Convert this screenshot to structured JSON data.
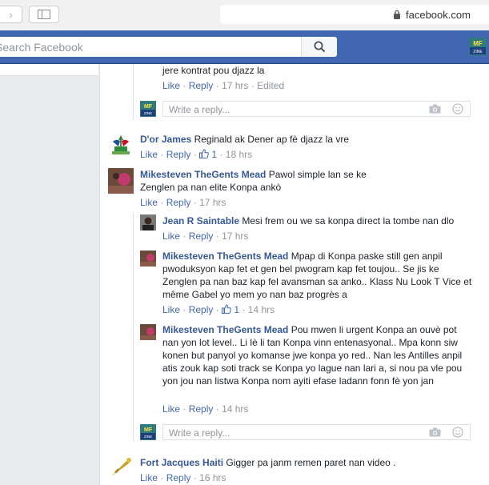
{
  "browser": {
    "url": "facebook.com",
    "back_glyph": "‹",
    "forward_glyph": "›"
  },
  "header": {
    "search_placeholder": "Search Facebook",
    "brand_color": "#4267b2"
  },
  "comments": [
    {
      "text_tail": "jere kontrat pou djazz la",
      "actions": {
        "like": "Like",
        "reply": "Reply",
        "time": "17 hrs",
        "edited": "Edited"
      }
    },
    {
      "name": "D'or James",
      "text": "Reginald ak Dener ap fè djazz la vre",
      "actions": {
        "like": "Like",
        "reply": "Reply",
        "likes_count": "1",
        "time": "18 hrs"
      }
    },
    {
      "name": "Mikesteven TheGents Mead",
      "text": "Pawol simple lan se ke Zenglen pa nan elite Konpa ankò",
      "actions": {
        "like": "Like",
        "reply": "Reply",
        "time": "17 hrs"
      },
      "replies": [
        {
          "name": "Jean R Saintable",
          "text": "Mesi frem ou we sa konpa direct la tombe nan dlo",
          "actions": {
            "like": "Like",
            "reply": "Reply",
            "time": "17 hrs"
          }
        },
        {
          "name": "Mikesteven TheGents Mead",
          "text": "Mpap di Konpa paske still gen anpil pwoduksyon kap fet et gen bel pwogram kap fet toujou.. Se jis ke Zenglen pa nan baz kap fel avansman sa anko.. Klass Nu Look T Vice et même Gabel yo mem yo nan baz progrès a",
          "actions": {
            "like": "Like",
            "reply": "Reply",
            "likes_count": "1",
            "time": "14 hrs"
          }
        },
        {
          "name": "Mikesteven TheGents Mead",
          "text": "Pou mwen li urgent Konpa an ouvè pot nan yon lot level.. Li lè li tan Konpa vinn entenasyonal.. Mpa konn siw konen but panyol yo komanse jwe konpa yo red.. Nan les Antilles anpil atis zouk kap soti track se Konpa yo lague nan lari a, si nou pa vle pou yon jou nan listwa Konpa nom ayiti efase ladann fonn fè yon jan",
          "actions": {
            "like": "Like",
            "reply": "Reply",
            "time": "14 hrs"
          }
        }
      ]
    },
    {
      "name": "Fort Jacques Haiti",
      "text": "Gigger pa janm remen paret nan video .",
      "actions": {
        "like": "Like",
        "reply": "Reply",
        "time": "16 hrs"
      }
    }
  ],
  "reply_box": {
    "placeholder": "Write a reply..."
  },
  "separator": "·",
  "logo_text": {
    "top": "MF",
    "bottom": "ZINE"
  }
}
